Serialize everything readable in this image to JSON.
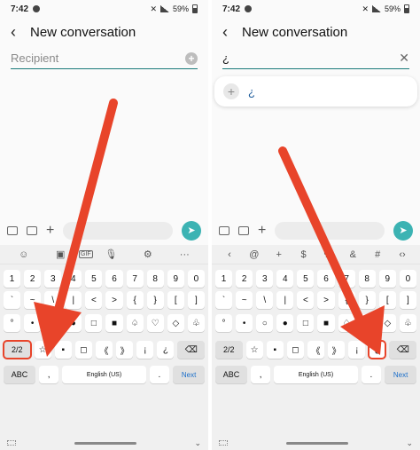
{
  "left": {
    "status": {
      "time": "7:42",
      "battery": "59%"
    },
    "header": {
      "back": "‹",
      "title": "New conversation"
    },
    "recipient": {
      "placeholder": "Recipient",
      "value": ""
    },
    "toolbar": [
      "☺",
      "▣",
      "GIF",
      "🎙",
      "⚙",
      "···"
    ],
    "rows": [
      [
        "1",
        "2",
        "3",
        "4",
        "5",
        "6",
        "7",
        "8",
        "9",
        "0"
      ],
      [
        "`",
        "~",
        "\\",
        "|",
        "<",
        ">",
        "{",
        "}",
        "[",
        "]"
      ],
      [
        "°",
        "•",
        "○",
        "●",
        "□",
        "■",
        "♤",
        "♡",
        "◇",
        "♧"
      ],
      [
        "2/2",
        "☆",
        "▪",
        "◻",
        "《",
        "》",
        "¡",
        "¿",
        "⌫"
      ],
      [
        "ABC",
        ",",
        "English (US)",
        ".",
        "Next"
      ]
    ],
    "highlight_key": "2/2"
  },
  "right": {
    "status": {
      "time": "7:42",
      "battery": "59%"
    },
    "header": {
      "back": "‹",
      "title": "New conversation"
    },
    "recipient": {
      "value": "¿"
    },
    "suggestion": {
      "value": "¿"
    },
    "toolbar": [
      "‹",
      "@",
      "+",
      "$",
      "%",
      "&",
      "#",
      "‹›"
    ],
    "rows": [
      [
        "1",
        "2",
        "3",
        "4",
        "5",
        "6",
        "7",
        "8",
        "9",
        "0"
      ],
      [
        "`",
        "~",
        "\\",
        "|",
        "<",
        ">",
        "{",
        "}",
        "[",
        "]"
      ],
      [
        "°",
        "•",
        "○",
        "●",
        "□",
        "■",
        "♤",
        "♡",
        "◇",
        "♧"
      ],
      [
        "2/2",
        "☆",
        "▪",
        "◻",
        "《",
        "》",
        "¡",
        "¿",
        "⌫"
      ],
      [
        "ABC",
        ",",
        "English (US)",
        ".",
        "Next"
      ]
    ],
    "highlight_key": "¿"
  },
  "colors": {
    "accent": "#1a7a7a",
    "send": "#3cb3b3",
    "arrow": "#e8442a",
    "next": "#1a6ec9"
  }
}
